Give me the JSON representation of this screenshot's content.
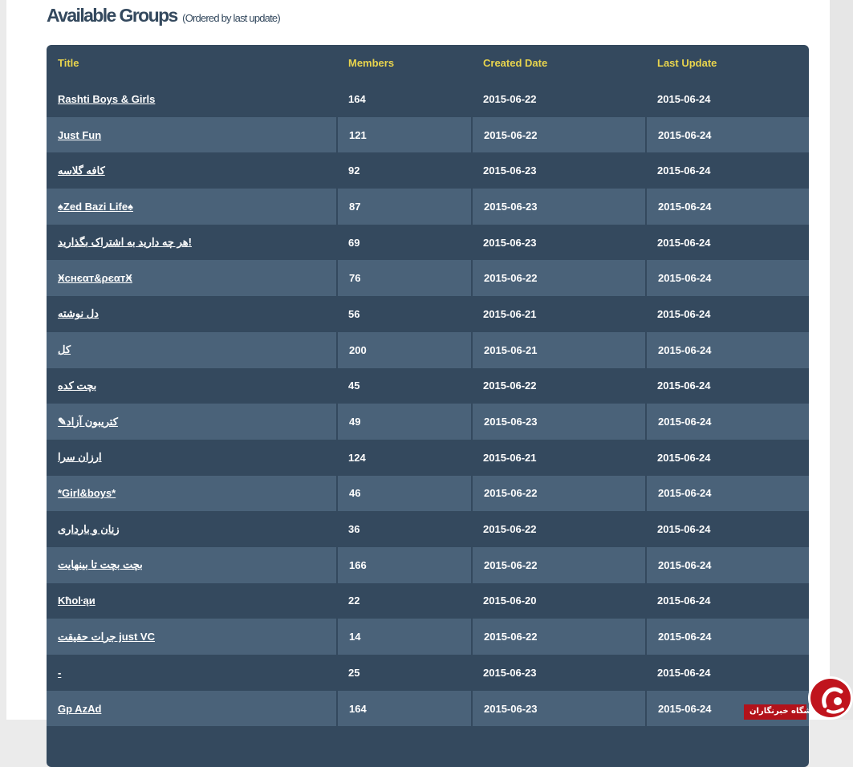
{
  "heading": {
    "title": "Available Groups",
    "subtitle": "(Ordered by last update)"
  },
  "table": {
    "headers": [
      "Title",
      "Members",
      "Created Date",
      "Last Update"
    ],
    "rows": [
      {
        "title": "Rashti Boys & Girls",
        "members": "164",
        "created": "2015-06-22",
        "updated": "2015-06-24"
      },
      {
        "title": "Just Fun",
        "members": "121",
        "created": "2015-06-22",
        "updated": "2015-06-24"
      },
      {
        "title": "کافه گلاسه",
        "members": "92",
        "created": "2015-06-23",
        "updated": "2015-06-24"
      },
      {
        "title": "♠Zed Bazi Life♠",
        "members": "87",
        "created": "2015-06-23",
        "updated": "2015-06-24"
      },
      {
        "title": "هر چه دارید به اشتراک بگذارید!",
        "members": "69",
        "created": "2015-06-23",
        "updated": "2015-06-24"
      },
      {
        "title": "Ӿcнєαт&ρєαтӾ",
        "members": "76",
        "created": "2015-06-22",
        "updated": "2015-06-24"
      },
      {
        "title": "دل نوشته",
        "members": "56",
        "created": "2015-06-21",
        "updated": "2015-06-24"
      },
      {
        "title": "کل",
        "members": "200",
        "created": "2015-06-21",
        "updated": "2015-06-24"
      },
      {
        "title": "   بچت کده   ",
        "members": "45",
        "created": "2015-06-22",
        "updated": "2015-06-24"
      },
      {
        "title": "✎کتریبون آزاد",
        "members": "49",
        "created": "2015-06-23",
        "updated": "2015-06-24"
      },
      {
        "title": "ارزان سرا",
        "members": "124",
        "created": "2015-06-21",
        "updated": "2015-06-24"
      },
      {
        "title": "*Girl&boys*",
        "members": "46",
        "created": "2015-06-22",
        "updated": "2015-06-24"
      },
      {
        "title": "زنان و بارداری",
        "members": "36",
        "created": "2015-06-22",
        "updated": "2015-06-24"
      },
      {
        "title": "بچت بچت تا بینهایت",
        "members": "166",
        "created": "2015-06-22",
        "updated": "2015-06-24"
      },
      {
        "title": "Kћoŀąи",
        "members": "22",
        "created": "2015-06-20",
        "updated": "2015-06-24"
      },
      {
        "title": "جرات حقیقت just VC",
        "members": "14",
        "created": "2015-06-22",
        "updated": "2015-06-24"
      },
      {
        "title": "-",
        "members": "25",
        "created": "2015-06-23",
        "updated": "2015-06-24"
      },
      {
        "title": "Gp AzAd",
        "members": "164",
        "created": "2015-06-23",
        "updated": "2015-06-24"
      }
    ]
  },
  "watermark": {
    "text": "باشگاه خبرنگاران"
  },
  "colors": {
    "header_text": "#e8d44d",
    "row_dark": "#34495e",
    "row_light": "#4a6279",
    "heading": "#34495e",
    "badge": "#b3121a"
  }
}
